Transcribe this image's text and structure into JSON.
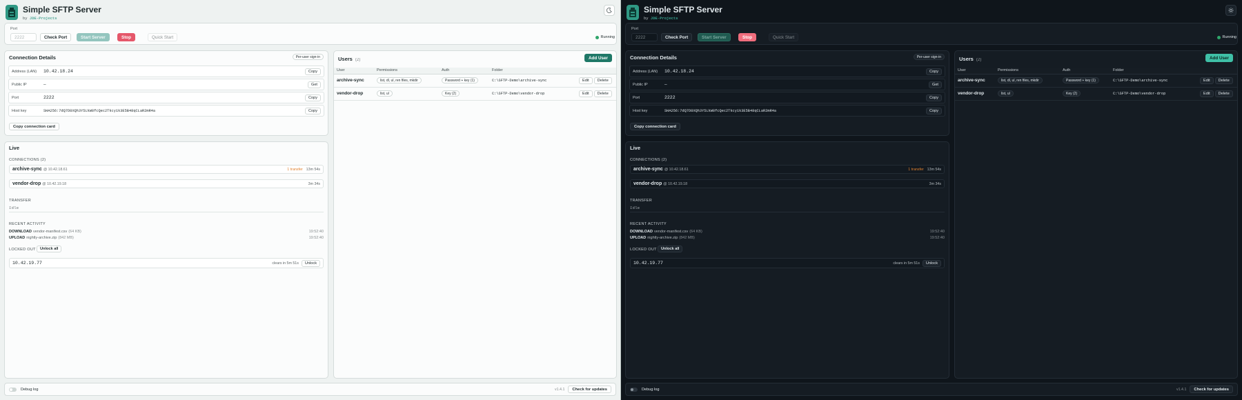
{
  "app": {
    "title": "Simple SFTP Server",
    "by_prefix": "by",
    "by_org": "JDE-Projects",
    "status": "Running"
  },
  "controls": {
    "port_label": "Port",
    "port_placeholder": "2222",
    "check_port": "Check Port",
    "start_server": "Start Server",
    "stop": "Stop",
    "quick_start": "Quick Start"
  },
  "connection": {
    "title": "Connection Details",
    "badge": "Per-user sign-in",
    "rows": [
      {
        "label": "Address (LAN)",
        "value": "10.42.18.24",
        "action": "Copy"
      },
      {
        "label": "Public IP",
        "value": "–",
        "action": "Get"
      },
      {
        "label": "Port",
        "value": "2222",
        "action": "Copy"
      },
      {
        "label": "Host key",
        "value": "SHA256:7dQ7D8XQh3Y5LkW8fcQec2Tkcy1k3E5B48qCLaR2mR4a",
        "action": "Copy"
      }
    ],
    "copy_card": "Copy connection card"
  },
  "live": {
    "title": "Live",
    "connections_label": "CONNECTIONS (2)",
    "connections": [
      {
        "user": "archive-sync",
        "ip": "@ 10.42.18.61",
        "transfer": "1 transfer",
        "duration": "13m 54s"
      },
      {
        "user": "vendor-drop",
        "ip": "@ 10.42.19.18",
        "transfer": "",
        "duration": "3m 34s"
      }
    ],
    "transfer_label": "TRANSFER",
    "transfer_state": "Idle",
    "activity_label": "RECENT ACTIVITY",
    "activity": [
      {
        "type": "DOWNLOAD",
        "file": "vendor-manifest.csv",
        "size": "(64 KB)",
        "time": "19:52:40"
      },
      {
        "type": "UPLOAD",
        "file": "nightly-archive.zip",
        "size": "(842 MB)",
        "time": "19:52:40"
      }
    ],
    "locked_label": "LOCKED OUT",
    "unlock_all": "Unlock all",
    "locked": {
      "ip": "10.42.19.77",
      "clears": "clears in 5m 51s",
      "action": "Unlock"
    }
  },
  "users": {
    "title": "Users",
    "count": "(2)",
    "add_user": "Add User",
    "columns": [
      "User",
      "Permissions",
      "Auth",
      "Folder"
    ],
    "rows": [
      {
        "user": "archive-sync",
        "perms": "list, dl, ul, ren files, mkdir",
        "auth": "Password + key (1)",
        "folder": "C:\\SFTP-Demo\\archive-sync",
        "edit": "Edit",
        "delete": "Delete"
      },
      {
        "user": "vendor-drop",
        "perms": "list, ul",
        "auth": "Key (2)",
        "folder": "C:\\SFTP-Demo\\vendor-drop",
        "edit": "Edit",
        "delete": "Delete"
      }
    ]
  },
  "footer": {
    "debug_log": "Debug log",
    "version": "v1.4.1",
    "check_updates": "Check for updates"
  },
  "colors": {
    "accent": "#2f9884",
    "stop": "#e5576a",
    "running": "#2fa56a",
    "transfer": "#e0802e"
  }
}
